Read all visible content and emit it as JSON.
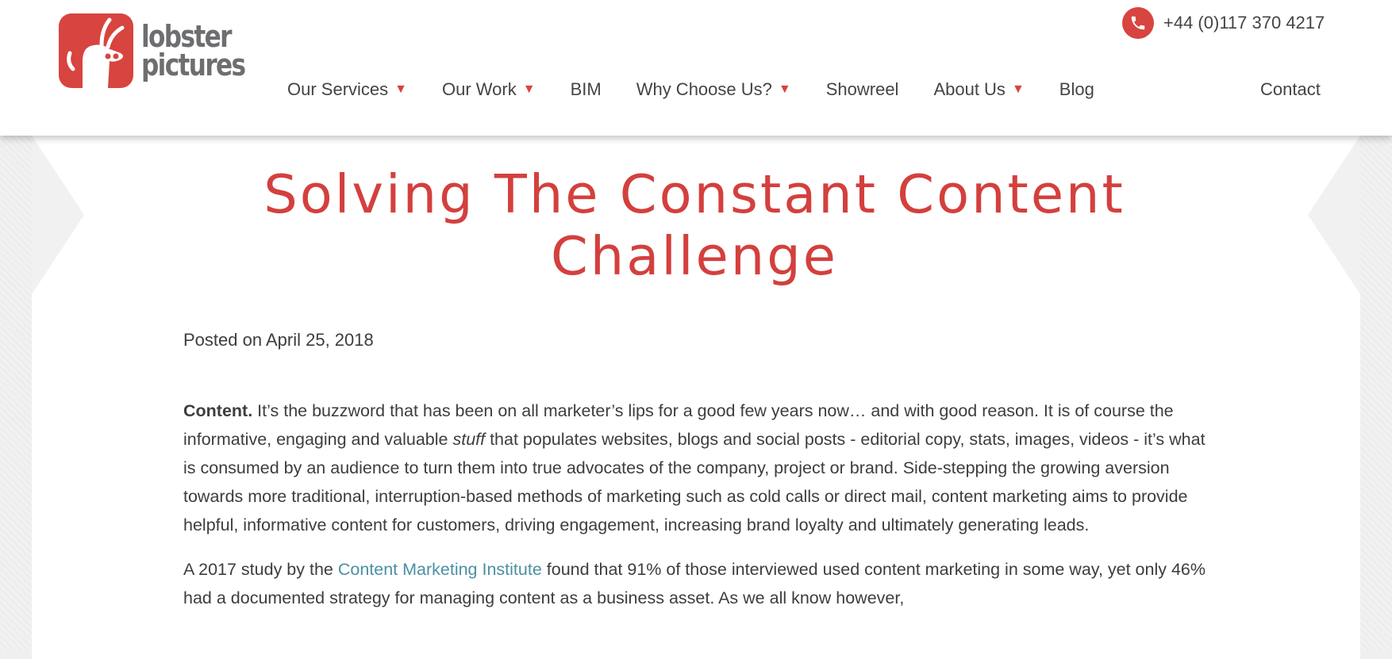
{
  "header": {
    "logo_line1": "lobster",
    "logo_line2": "pictures",
    "phone": "+44 (0)117 370 4217"
  },
  "nav": {
    "items": [
      {
        "label": "Our Services",
        "has_dropdown": true
      },
      {
        "label": "Our Work",
        "has_dropdown": true
      },
      {
        "label": "BIM",
        "has_dropdown": false
      },
      {
        "label": "Why Choose Us?",
        "has_dropdown": true
      },
      {
        "label": "Showreel",
        "has_dropdown": false
      },
      {
        "label": "About Us",
        "has_dropdown": true
      },
      {
        "label": "Blog",
        "has_dropdown": false
      }
    ],
    "contact": "Contact",
    "caret": "▼"
  },
  "article": {
    "title": "Solving The Constant Content Challenge",
    "posted_prefix": "Posted on",
    "posted_date": "April 25, 2018",
    "p1_lead": "Content.",
    "p1_a": " It’s the buzzword that has been on all marketer’s lips for a good few years now… and with good reason. It is of course the informative, engaging and valuable ",
    "p1_em": "stuff",
    "p1_b": " that populates websites, blogs and social posts - editorial copy, stats, images, videos -  it’s what is consumed by an audience to turn them into true advocates of the company, project or brand. Side-stepping the growing aversion towards more traditional, interruption-based methods of marketing such as cold calls or direct mail, content marketing aims to provide helpful, informative content for customers, driving engagement, increasing brand loyalty and ultimately generating leads.",
    "p2_a": "A 2017 study by the ",
    "p2_link": "Content Marketing Institute",
    "p2_b": " found that 91% of those interviewed used content marketing in some way, yet only 46% had a documented strategy for managing content as a business asset. As we all know however,"
  },
  "colors": {
    "brand_red": "#d8443f",
    "title_red": "#d3403d",
    "link_teal": "#4a90a4",
    "text_dark": "#3d3d3d",
    "logo_grey": "#6d6e70"
  },
  "icons": {
    "phone": "phone-icon",
    "logo": "lobster-logo-icon"
  }
}
